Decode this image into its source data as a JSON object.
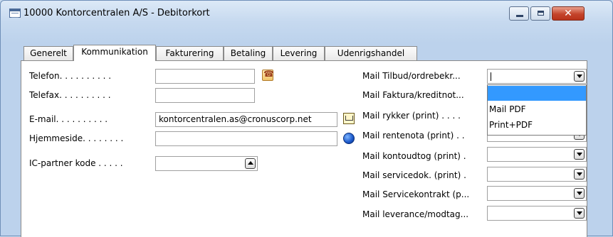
{
  "window": {
    "title": "10000 Kontorcentralen A/S - Debitorkort",
    "controls": [
      "minimize",
      "maximize",
      "close"
    ],
    "close_glyph": "✕"
  },
  "tabs": [
    "Generelt",
    "Kommunikation",
    "Fakturering",
    "Betaling",
    "Levering",
    "Udenrigshandel"
  ],
  "active_tab": "Kommunikation",
  "left_fields": {
    "telefon_label": "Telefon. . . . . . . . . .",
    "telefon_value": "",
    "telefax_label": "Telefax. . . . . . . . . .",
    "telefax_value": "",
    "email_label": "E-mail. . . . . . . . . .",
    "email_value": "kontorcentralen.as@cronuscorp.net",
    "hjemmeside_label": "Hjemmeside. . . . . . . .",
    "hjemmeside_value": "",
    "ic_label": "IC-partner kode . . . . .",
    "ic_value": ""
  },
  "right_fields": [
    {
      "label": "Mail Tilbud/ordrebekr...",
      "value": ""
    },
    {
      "label": "Mail Faktura/kreditnot...",
      "value": ""
    },
    {
      "label": "Mail rykker (print) . . . .",
      "value": ""
    },
    {
      "label": "Mail rentenota (print) . .",
      "value": ""
    },
    {
      "label": "Mail kontoudtog (print) .",
      "value": ""
    },
    {
      "label": "Mail servicedok. (print) .",
      "value": ""
    },
    {
      "label": "Mail Servicekontrakt (p...",
      "value": ""
    },
    {
      "label": "Mail leverance/modtag...",
      "value": ""
    }
  ],
  "dropdown_options": [
    "",
    "Mail PDF",
    "Print+PDF"
  ],
  "icons": {
    "title": "form-icon",
    "telefon": "phone-icon",
    "email": "mail-icon",
    "hjemmeside": "globe-icon"
  },
  "colors": {
    "selection": "#3399ff",
    "close_button": "#c4442b"
  }
}
